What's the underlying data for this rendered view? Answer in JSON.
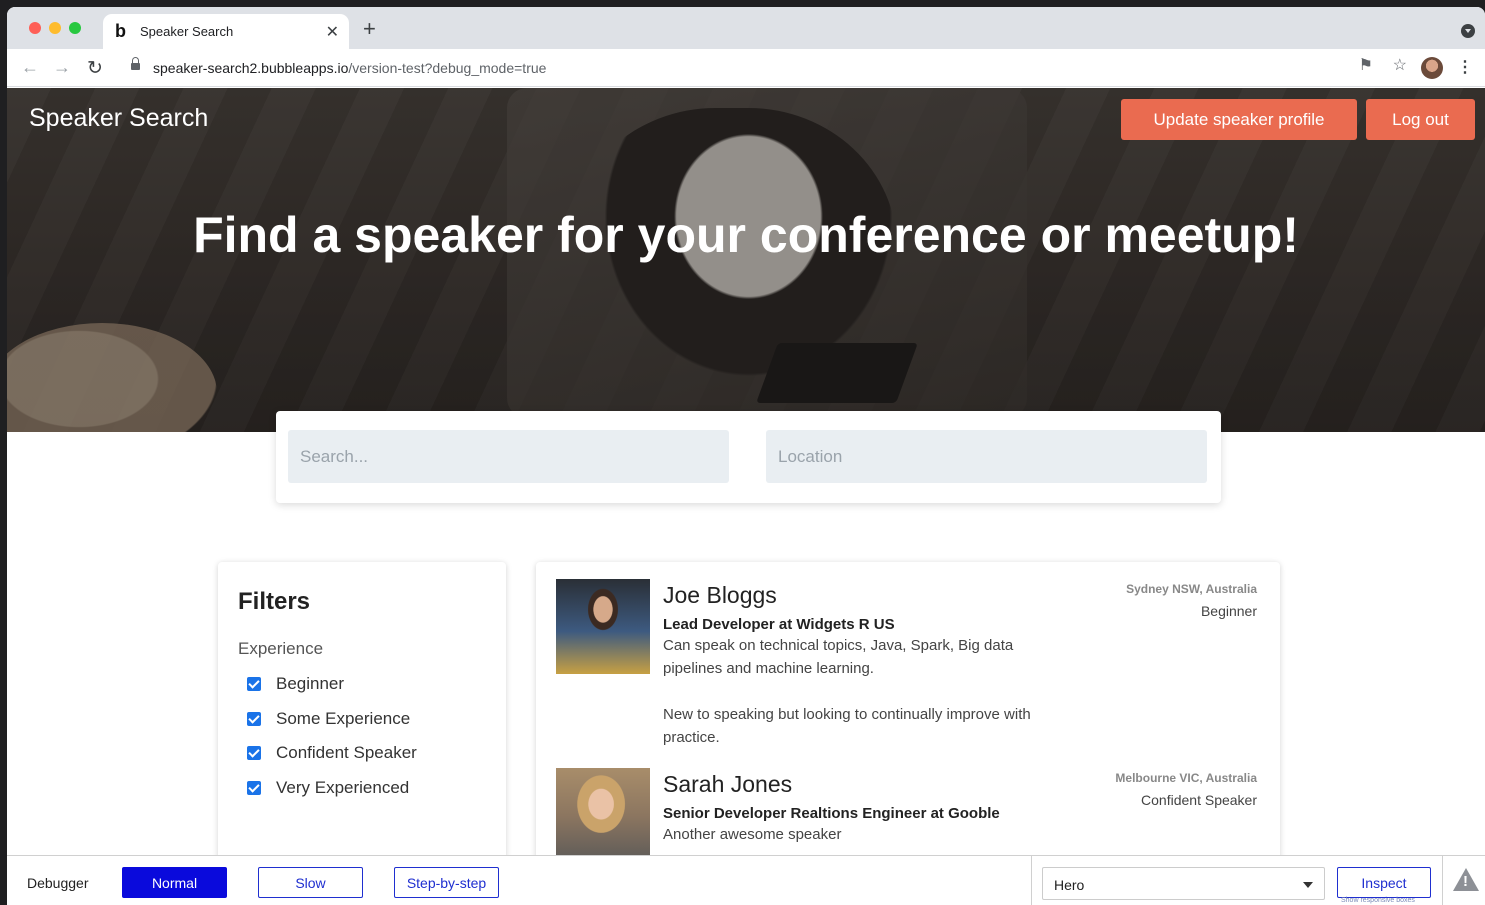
{
  "browser": {
    "tab_title": "Speaker Search",
    "favicon_letter": "b",
    "url_host": "speaker-search2.bubbleapps.io",
    "url_path": "/version-test?debug_mode=true"
  },
  "header": {
    "brand": "Speaker Search",
    "update_profile_label": "Update speaker profile",
    "logout_label": "Log out"
  },
  "hero": {
    "title": "Find a speaker for your conference or meetup!"
  },
  "search": {
    "search_placeholder": "Search...",
    "location_placeholder": "Location"
  },
  "filters": {
    "title": "Filters",
    "subtitle": "Experience",
    "options": [
      {
        "label": "Beginner",
        "checked": true
      },
      {
        "label": "Some Experience",
        "checked": true
      },
      {
        "label": "Confident Speaker",
        "checked": true
      },
      {
        "label": "Very Experienced",
        "checked": true
      }
    ]
  },
  "speakers": [
    {
      "name": "Joe Bloggs",
      "role": "Lead Developer at Widgets R US",
      "desc_1": "Can speak on technical topics, Java, Spark, Big data pipelines and machine learning.",
      "desc_2": "New to speaking but looking to continually improve with practice.",
      "location": "Sydney NSW, Australia",
      "level": "Beginner"
    },
    {
      "name": "Sarah Jones",
      "role": "Senior Developer Realtions Engineer at Gooble",
      "desc_1": "Another awesome speaker",
      "location": "Melbourne VIC, Australia",
      "level": "Confident Speaker"
    }
  ],
  "debugger": {
    "label": "Debugger",
    "normal_label": "Normal",
    "slow_label": "Slow",
    "step_label": "Step-by-step",
    "element_select_value": "Hero",
    "inspect_label": "Inspect",
    "hint": "Show responsive boxes"
  },
  "colors": {
    "accent": "#ea6b50",
    "debugger_blue": "#0a0adc",
    "checkbox_blue": "#1a73e8"
  }
}
